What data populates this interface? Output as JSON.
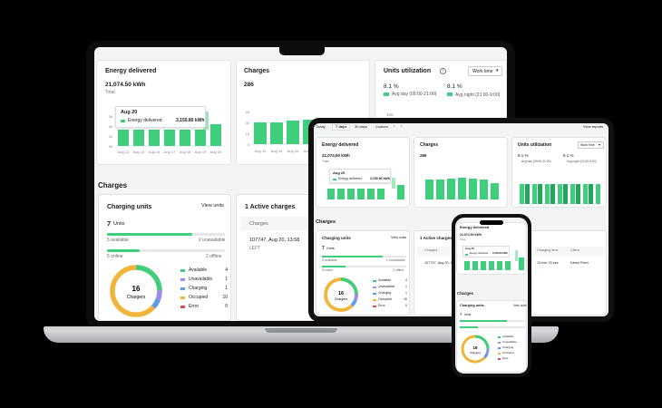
{
  "laptop": {
    "energy": {
      "title": "Energy delivered",
      "total_value": "21,074.50 kWh",
      "total_label": "Total",
      "tooltip_date": "Aug 20",
      "tooltip_label": "Energy delivered",
      "tooltip_value": "3,150.80 kWh",
      "y_ticks": [
        "3k",
        "2k",
        "1k",
        "0k"
      ],
      "x_ticks": [
        "Aug 14",
        "Aug 15",
        "Aug 16",
        "Aug 17",
        "Aug 18",
        "Aug 19",
        "Aug 20"
      ]
    },
    "charges": {
      "title": "Charges",
      "count": "286",
      "y_ticks": [
        "45",
        "30",
        "15",
        "0"
      ],
      "x_ticks": [
        "Aug 14",
        "Aug 15",
        "Aug 16",
        "Aug 17",
        "Aug 18"
      ]
    },
    "utilization": {
      "title": "Units utilization",
      "dropdown": "Work time",
      "day_pct": "8.1 %",
      "day_label": "Avg day (09:00-21:00)",
      "night_pct": "8.1 %",
      "night_label": "Avg night (21:00-9:00)",
      "y_tick": "100"
    },
    "section_title": "Charges",
    "units": {
      "title": "Charging units",
      "view_link": "View units",
      "count": "7",
      "count_label": "Units",
      "available": "5 available",
      "unavailable": "2 unavailable",
      "online": "5 online",
      "offline": "2 offline",
      "donut_value": "16",
      "donut_label": "Chargers",
      "legend": [
        {
          "label": "Available",
          "value": "4",
          "color": "#3fce7b"
        },
        {
          "label": "Unavailable",
          "value": "1",
          "color": "#9b8cf2"
        },
        {
          "label": "Charging",
          "value": "1",
          "color": "#5b9cf0"
        },
        {
          "label": "Occupied",
          "value": "10",
          "color": "#f2b53c"
        },
        {
          "label": "Error",
          "value": "0",
          "color": "#e8484e"
        }
      ]
    },
    "active": {
      "title": "1 Active charges",
      "col": "Charges",
      "row_value": "107747, Aug 20, 13:58",
      "row_sub": "LEFT"
    }
  },
  "tablet": {
    "tabs": [
      "Today",
      "7 days",
      "30 days",
      "Custom"
    ],
    "view_reports": "View reports",
    "energy_title": "Energy delivered",
    "energy_value": "21,074.50 kWh",
    "energy_total": "Total",
    "tooltip_date": "Aug 20",
    "tooltip_label": "Energy delivered",
    "tooltip_value": "3,150.80 kWh",
    "charges_title": "Charges",
    "charges_value": "286",
    "util_title": "Units utilization",
    "util_dropdown": "Work time",
    "day_pct": "8.1 %",
    "day_label": "Avg day (09:00-21:00)",
    "night_pct": "8.1 %",
    "night_label": "Avg night (21:00-9:00)",
    "section_title": "Charges",
    "units_title": "Charging units",
    "view_units": "View units",
    "units_count": "7",
    "units_label": "Units",
    "available": "5 available",
    "unavailable": "2 unavailable",
    "online": "5 online",
    "offline": "2 offline",
    "donut_value": "16",
    "donut_label": "Chargers",
    "legend": [
      {
        "label": "Available",
        "value": "4"
      },
      {
        "label": "Unavailable",
        "value": "1"
      },
      {
        "label": "Charging",
        "value": "1"
      },
      {
        "label": "Occupied",
        "value": "10"
      },
      {
        "label": "Error",
        "value": "0"
      }
    ],
    "active_title": "1 Active charges",
    "active_col": "Charges",
    "active_row": "107747, Aug 20, 13:58",
    "time_col": "Charging time",
    "time_value": "13 min 33 sec",
    "client_col": "Client",
    "client_value": "Demo Fleet"
  },
  "phone": {
    "energy_title": "Energy delivered",
    "energy_value": "21,074.50 kWh",
    "energy_total": "Total",
    "tooltip_date": "Aug 20",
    "tooltip_label": "Energy delivered",
    "tooltip_value": "3,150.80 kWh",
    "section_title": "Charges",
    "units_title": "Charging units",
    "view_units": "View units",
    "units_count": "7",
    "units_label": "Units",
    "donut_value": "16",
    "donut_label": "Chargers",
    "legend": [
      "Available",
      "Unavailable",
      "Charging",
      "Occupied",
      "Error"
    ]
  },
  "colors": {
    "accent": "#3fce7b",
    "accent_light": "#a3e9c0",
    "occupied": "#f2b53c",
    "unavailable": "#9b8cf2",
    "charging": "#5b9cf0",
    "error": "#e8484e"
  }
}
